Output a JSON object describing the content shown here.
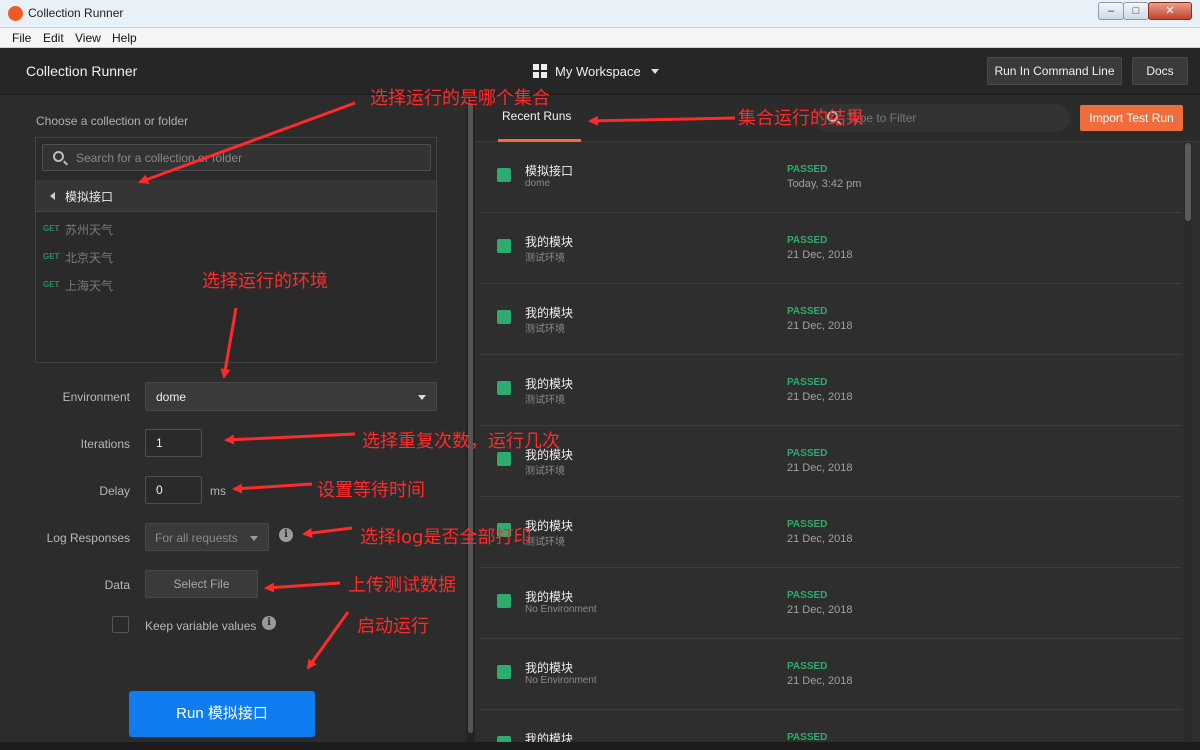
{
  "window": {
    "title": "Collection Runner",
    "minimize_glyph": "–",
    "maximize_glyph": "□",
    "close_glyph": "✕"
  },
  "menu": [
    "File",
    "Edit",
    "View",
    "Help"
  ],
  "header": {
    "title": "Collection Runner",
    "workspace": "My Workspace",
    "run_cmd_label": "Run In Command Line",
    "docs_label": "Docs"
  },
  "left": {
    "choose_label": "Choose a collection or folder",
    "search_placeholder": "Search for a collection or folder",
    "collection_name": "模拟接口",
    "requests": [
      {
        "method": "GET",
        "name": "苏州天气"
      },
      {
        "method": "GET",
        "name": "北京天气"
      },
      {
        "method": "GET",
        "name": "上海天气"
      }
    ],
    "environment_label": "Environment",
    "environment_value": "dome",
    "iterations_label": "Iterations",
    "iterations_value": "1",
    "delay_label": "Delay",
    "delay_value": "0",
    "delay_unit": "ms",
    "log_label": "Log Responses",
    "log_value": "For all requests",
    "data_label": "Data",
    "select_file_label": "Select File",
    "keep_values_label": "Keep variable values",
    "run_button": "Run 模拟接口"
  },
  "right": {
    "tab_label": "Recent Runs",
    "filter_placeholder": "Type to Filter",
    "import_label": "Import Test Run",
    "runs": [
      {
        "name": "模拟接口",
        "env": "dome",
        "status": "PASSED",
        "date": "Today, 3:42 pm"
      },
      {
        "name": "我的模块",
        "env": "测试环境",
        "status": "PASSED",
        "date": "21 Dec, 2018"
      },
      {
        "name": "我的模块",
        "env": "测试环境",
        "status": "PASSED",
        "date": "21 Dec, 2018"
      },
      {
        "name": "我的模块",
        "env": "测试环境",
        "status": "PASSED",
        "date": "21 Dec, 2018"
      },
      {
        "name": "我的模块",
        "env": "测试环境",
        "status": "PASSED",
        "date": "21 Dec, 2018"
      },
      {
        "name": "我的模块",
        "env": "测试环境",
        "status": "PASSED",
        "date": "21 Dec, 2018"
      },
      {
        "name": "我的模块",
        "env": "No Environment",
        "status": "PASSED",
        "date": "21 Dec, 2018"
      },
      {
        "name": "我的模块",
        "env": "No Environment",
        "status": "PASSED",
        "date": "21 Dec, 2018"
      },
      {
        "name": "我的模块",
        "env": "",
        "status": "PASSED",
        "date": ""
      }
    ]
  },
  "annotations": {
    "collection": "选择运行的是哪个集合",
    "results": "集合运行的结果",
    "environment": "选择运行的环境",
    "iterations": "选择重复次数，运行几次",
    "delay": "设置等待时间",
    "log": "选择log是否全部打印",
    "data": "上传测试数据",
    "run": "启动运行"
  },
  "colors": {
    "accent": "#ef6c3d",
    "run_button": "#0f7cf0",
    "passed": "#2eab6f",
    "annotation": "#ff2a2a"
  }
}
